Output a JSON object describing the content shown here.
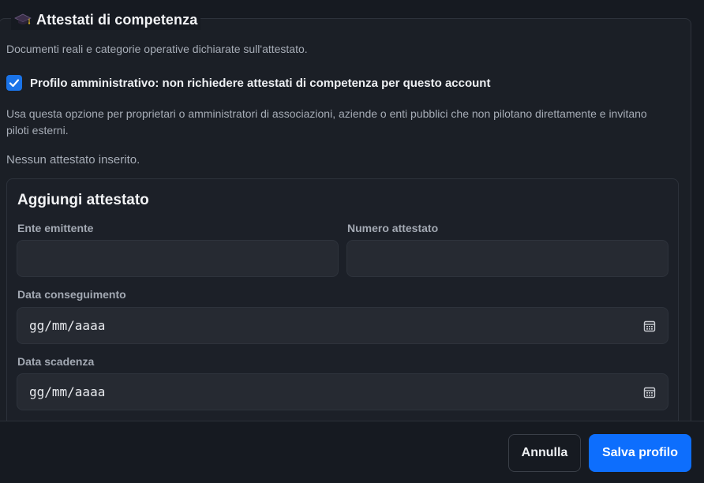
{
  "section": {
    "title": "Attestati di competenza",
    "icon": "graduation-cap-icon",
    "description": "Documenti reali e categorie operative dichiarate sull'attestato.",
    "admin_profile": {
      "checked": true,
      "label": "Profilo amministrativo: non richiedere attestati di competenza per questo account",
      "help": "Usa questa opzione per proprietari o amministratori di associazioni, aziende o enti pubblici che non pilotano direttamente e invitano piloti esterni."
    },
    "empty_text": "Nessun attestato inserito."
  },
  "add_form": {
    "title": "Aggiungi attestato",
    "fields": {
      "issuer": {
        "label": "Ente emittente",
        "value": ""
      },
      "number": {
        "label": "Numero attestato",
        "value": ""
      },
      "issue_date": {
        "label": "Data conseguimento",
        "placeholder": "gg/mm/aaaa"
      },
      "expiry_date": {
        "label": "Data scadenza",
        "placeholder": "gg/mm/aaaa"
      }
    }
  },
  "footer": {
    "cancel_label": "Annulla",
    "save_label": "Salva profilo"
  },
  "colors": {
    "background": "#161a21",
    "panel": "#1b1f26",
    "input": "#262a32",
    "accent": "#0d6efd",
    "checkbox": "#1a73e8"
  }
}
